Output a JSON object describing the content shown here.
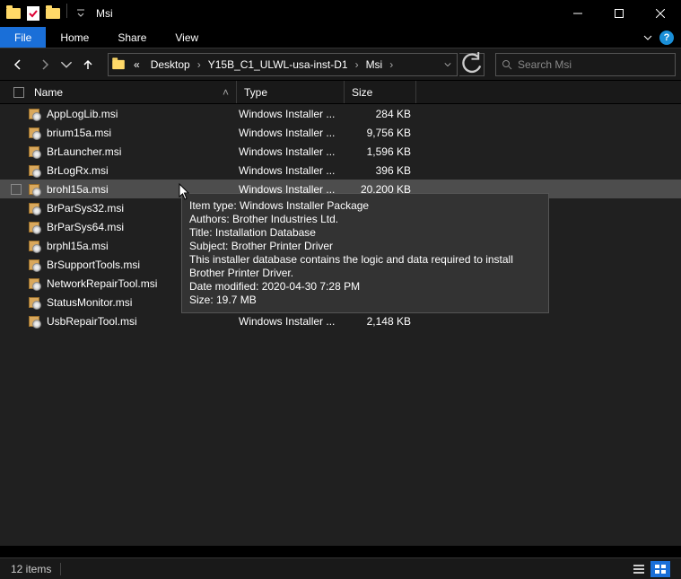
{
  "window": {
    "title": "Msi"
  },
  "ribbon": {
    "file": "File",
    "tabs": [
      "Home",
      "Share",
      "View"
    ]
  },
  "breadcrumbs": {
    "overflow": "«",
    "items": [
      "Desktop",
      "Y15B_C1_ULWL-usa-inst-D1",
      "Msi"
    ]
  },
  "search": {
    "placeholder": "Search Msi"
  },
  "columns": {
    "name": "Name",
    "type": "Type",
    "size": "Size"
  },
  "files": [
    {
      "name": "AppLogLib.msi",
      "type": "Windows Installer ...",
      "size": "284 KB"
    },
    {
      "name": "brium15a.msi",
      "type": "Windows Installer ...",
      "size": "9,756 KB"
    },
    {
      "name": "BrLauncher.msi",
      "type": "Windows Installer ...",
      "size": "1,596 KB"
    },
    {
      "name": "BrLogRx.msi",
      "type": "Windows Installer ...",
      "size": "396 KB"
    },
    {
      "name": "brohl15a.msi",
      "type": "Windows Installer ...",
      "size": "20,200 KB",
      "selected": true
    },
    {
      "name": "BrParSys32.msi",
      "type": "",
      "size": ""
    },
    {
      "name": "BrParSys64.msi",
      "type": "",
      "size": ""
    },
    {
      "name": "brphl15a.msi",
      "type": "",
      "size": ""
    },
    {
      "name": "BrSupportTools.msi",
      "type": "",
      "size": ""
    },
    {
      "name": "NetworkRepairTool.msi",
      "type": "",
      "size": ""
    },
    {
      "name": "StatusMonitor.msi",
      "type": "",
      "size": ""
    },
    {
      "name": "UsbRepairTool.msi",
      "type": "Windows Installer ...",
      "size": "2,148 KB"
    }
  ],
  "tooltip": {
    "l1": "Item type: Windows Installer Package",
    "l2": "Authors: Brother Industries Ltd.",
    "l3": "Title: Installation Database",
    "l4": "Subject: Brother Printer Driver",
    "l5": "This installer database contains the logic and data required to install Brother Printer Driver.",
    "l6": "Date modified: 2020-04-30 7:28 PM",
    "l7": "Size: 19.7 MB"
  },
  "status": {
    "count": "12 items"
  }
}
